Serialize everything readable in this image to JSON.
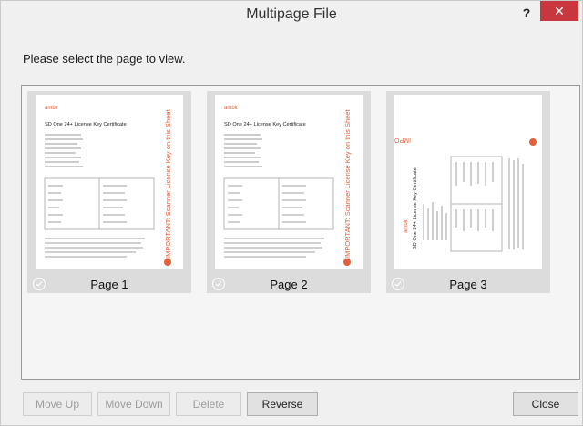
{
  "window": {
    "title": "Multipage File",
    "help_label": "?",
    "close_glyph": "✕",
    "close_color": "#c7373d"
  },
  "prompt": "Please select the page to view.",
  "pages": [
    {
      "label": "Page 1",
      "orientation": "portrait"
    },
    {
      "label": "Page 2",
      "orientation": "portrait"
    },
    {
      "label": "Page 3",
      "orientation": "rotated"
    }
  ],
  "thumbnail_text": {
    "brand": "ambir",
    "doc_title": "SD One 24+ License Key Certificate",
    "side_banner": "IMPORTANT: Scanner License Key on this Sheet",
    "accent_color": "#e3603a"
  },
  "buttons": {
    "move_up": "Move Up",
    "move_down": "Move Down",
    "delete": "Delete",
    "reverse": "Reverse",
    "close": "Close"
  }
}
